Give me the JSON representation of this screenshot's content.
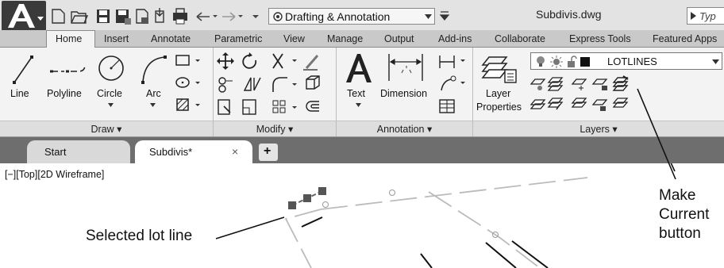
{
  "title_bar": {
    "workspace": "Drafting & Annotation",
    "filename": "Subdivis.dwg",
    "search_placeholder": "Typ"
  },
  "ribbon_tabs": [
    "Home",
    "Insert",
    "Annotate",
    "Parametric",
    "View",
    "Manage",
    "Output",
    "Add-ins",
    "Collaborate",
    "Express Tools",
    "Featured Apps"
  ],
  "active_tab": "Home",
  "draw": {
    "line": "Line",
    "polyline": "Polyline",
    "circle": "Circle",
    "arc": "Arc",
    "group": "Draw ▾"
  },
  "modify": {
    "group": "Modify ▾"
  },
  "annotation": {
    "text": "Text",
    "dimension": "Dimension",
    "group": "Annotation ▾"
  },
  "layers": {
    "layer_props_1": "Layer",
    "layer_props_2": "Properties",
    "current_layer": "LOTLINES",
    "group": "Layers ▾"
  },
  "doc_tabs": {
    "start": "Start",
    "active": "Subdivis*",
    "close": "×",
    "new": "+"
  },
  "viewport_label": "[−][Top][2D Wireframe]",
  "callouts": {
    "selected_line": "Selected lot line",
    "make_current_1": "Make",
    "make_current_2": "Current",
    "make_current_3": "button"
  },
  "colors": {
    "ribbon_bg": "#f3f3f3",
    "doc_tab_bar": "#6e6e6e",
    "active_tab": "#ffffff",
    "grip_fill": "#555555"
  }
}
